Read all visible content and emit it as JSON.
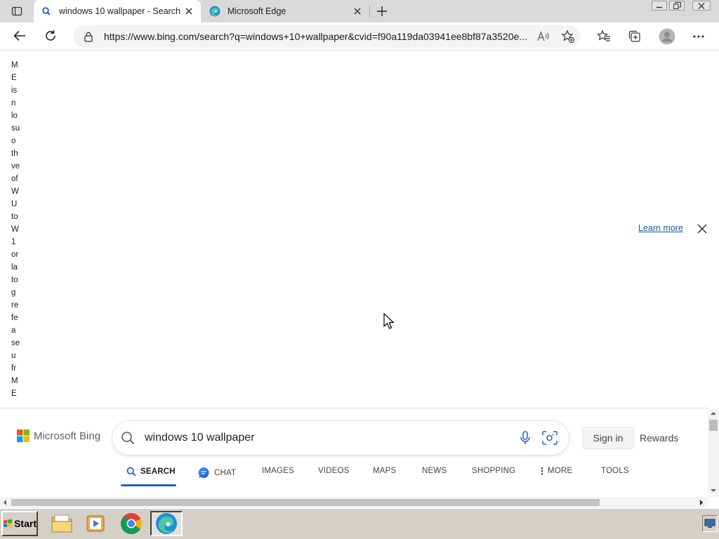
{
  "browser": {
    "tabs": [
      {
        "title": "windows 10 wallpaper - Search",
        "active": true,
        "favicon": "bing-search-icon"
      },
      {
        "title": "Microsoft Edge",
        "active": false,
        "favicon": "edge-icon"
      }
    ],
    "address": {
      "url": "https://www.bing.com/search?q=windows+10+wallpaper&cvid=f90a119da03941ee8bf87a3520e..."
    }
  },
  "notice": {
    "fragments": [
      "M",
      "E",
      "is",
      "n",
      "lo",
      "su",
      "o",
      "th",
      "ve",
      "of",
      "W",
      "U",
      "to",
      "W",
      "1",
      "or",
      "la",
      "to",
      "g",
      "re",
      "fe",
      "a",
      "se",
      "u",
      "fr",
      "M",
      "E"
    ],
    "learn_more": "Learn more"
  },
  "bing": {
    "brand": "Microsoft Bing",
    "query": "windows 10 wallpaper",
    "sign_in": "Sign in",
    "rewards": "Rewards",
    "nav": [
      {
        "label": "SEARCH",
        "icon": "search-icon",
        "active": true
      },
      {
        "label": "CHAT",
        "icon": "chat-icon",
        "active": false
      },
      {
        "label": "IMAGES",
        "active": false
      },
      {
        "label": "VIDEOS",
        "active": false
      },
      {
        "label": "MAPS",
        "active": false
      },
      {
        "label": "NEWS",
        "active": false
      },
      {
        "label": "SHOPPING",
        "active": false
      },
      {
        "label": "MORE",
        "icon": "more-vertical-icon",
        "active": false
      },
      {
        "label": "TOOLS",
        "active": false
      }
    ]
  },
  "taskbar": {
    "start": "Start",
    "apps": [
      {
        "name": "file-explorer"
      },
      {
        "name": "media-player"
      },
      {
        "name": "google-chrome"
      },
      {
        "name": "microsoft-edge",
        "active": true
      }
    ]
  },
  "colors": {
    "accent": "#1d62c6",
    "link": "#1a5aa9",
    "tabstrip": "#d9d9d9",
    "taskbar": "#d4d0c8"
  }
}
